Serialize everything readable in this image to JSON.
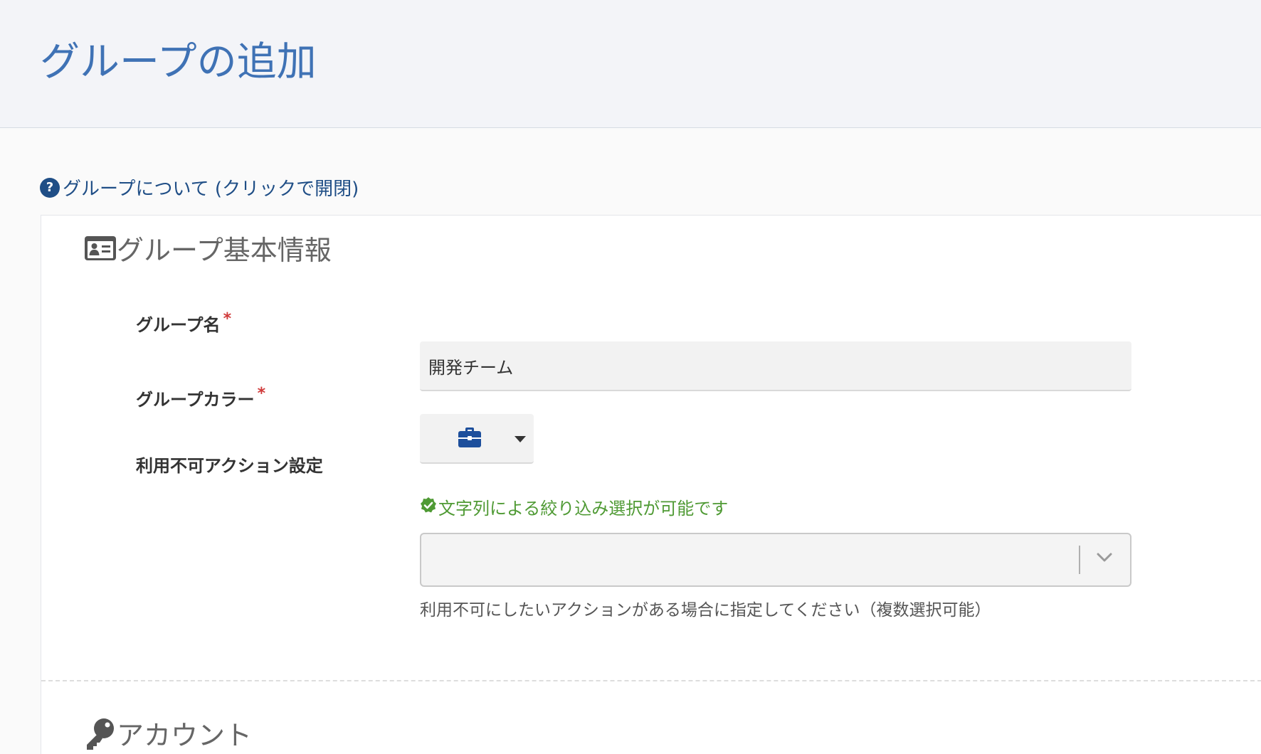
{
  "page": {
    "title": "グループの追加",
    "help_link": "グループについて (クリックで開閉)"
  },
  "basic_info": {
    "heading": "グループ基本情報",
    "group_name": {
      "label": "グループ名",
      "required_mark": "*",
      "value": "開発チーム"
    },
    "group_color": {
      "label": "グループカラー",
      "required_mark": "*",
      "selected_icon": "briefcase-icon",
      "icon_color": "#1d4f9c"
    },
    "restricted_actions": {
      "label": "利用不可アクション設定",
      "filter_hint": "文字列による絞り込み選択が可能です",
      "value": "",
      "help_text": "利用不可にしたいアクションがある場合に指定してください（複数選択可能）"
    }
  },
  "account": {
    "heading": "アカウント"
  },
  "colors": {
    "title_blue": "#3f72b5",
    "link_navy": "#1f4e86",
    "success_green": "#4f9a34",
    "required_red": "#d03a3a"
  }
}
